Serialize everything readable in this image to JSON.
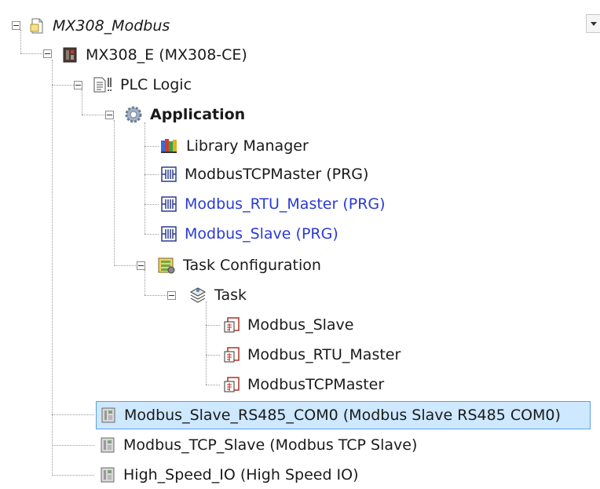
{
  "tree": {
    "root": {
      "label": "MX308_Modbus",
      "icon": "project-icon"
    },
    "device": {
      "label": "MX308_E (MX308-CE)",
      "icon": "plc-device-icon"
    },
    "plc_logic": {
      "label": "PLC Logic",
      "icon": "plc-logic-icon"
    },
    "application": {
      "label": "Application",
      "icon": "gear-icon"
    },
    "library_manager": {
      "label": "Library Manager",
      "icon": "library-books-icon"
    },
    "prg_tcp_master": {
      "label": "ModbusTCPMaster (PRG)",
      "icon": "program-icon"
    },
    "prg_rtu_master": {
      "label": "Modbus_RTU_Master (PRG)",
      "icon": "program-icon"
    },
    "prg_slave": {
      "label": "Modbus_Slave (PRG)",
      "icon": "program-icon"
    },
    "task_configuration": {
      "label": "Task Configuration",
      "icon": "task-configuration-icon"
    },
    "task": {
      "label": "Task",
      "icon": "task-stack-icon"
    },
    "call_slave": {
      "label": "Modbus_Slave",
      "icon": "program-call-icon"
    },
    "call_rtu_master": {
      "label": "Modbus_RTU_Master",
      "icon": "program-call-icon"
    },
    "call_tcp_master": {
      "label": "ModbusTCPMaster",
      "icon": "program-call-icon"
    },
    "dev_rs485_com0": {
      "label": "Modbus_Slave_RS485_COM0 (Modbus Slave RS485 COM0)",
      "icon": "io-module-icon"
    },
    "dev_tcp_slave": {
      "label": "Modbus_TCP_Slave (Modbus TCP Slave)",
      "icon": "io-module-icon"
    },
    "dev_high_speed_io": {
      "label": "High_Speed_IO (High Speed IO)",
      "icon": "io-module-icon"
    }
  },
  "colors": {
    "link_text": "#2a3ad6",
    "selection_fill": "#cde8ff",
    "selection_border": "#5aa0dc"
  }
}
